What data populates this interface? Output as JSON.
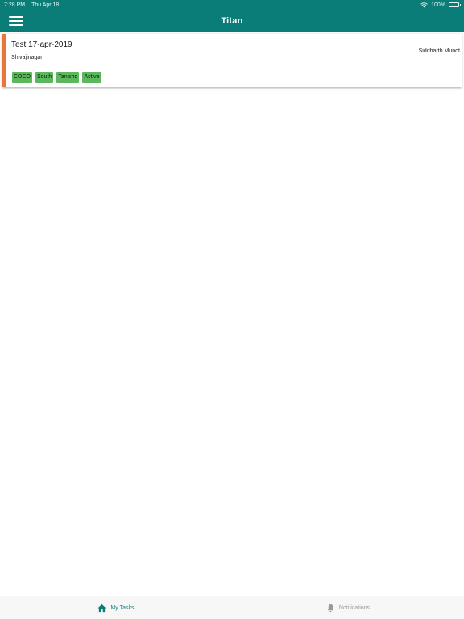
{
  "status_bar": {
    "time": "7:28 PM",
    "date": "Thu Apr 18",
    "battery": "100%",
    "wifi_icon": "wifi-icon",
    "battery_icon": "battery-icon"
  },
  "header": {
    "title": "Titan",
    "menu_icon": "hamburger-menu-icon",
    "background_color": "#0a7d78"
  },
  "tasks": [
    {
      "title": "Test 17-apr-2019",
      "location": "Shivajinagar",
      "owner": "Siddharth Munot",
      "accent_color": "#e8773a",
      "tags": [
        "COCO",
        "South",
        "Tanishq",
        "Active"
      ],
      "tag_color": "#5cb85c"
    }
  ],
  "tab_bar": {
    "tabs": [
      {
        "label": "My Tasks",
        "icon": "home-icon",
        "active": true
      },
      {
        "label": "Notifications",
        "icon": "bell-icon",
        "active": false
      }
    ]
  }
}
